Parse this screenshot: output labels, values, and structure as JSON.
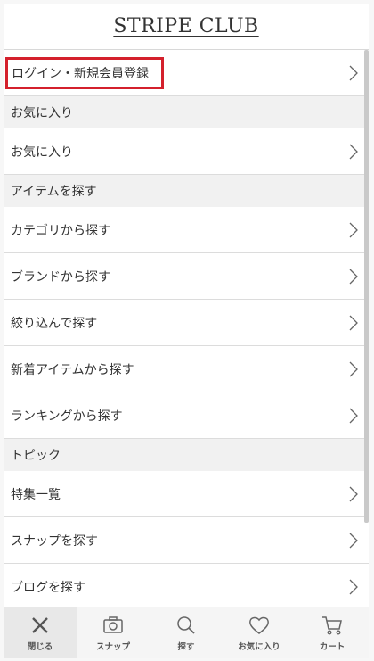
{
  "header": {
    "logo": "STRIPE CLUB"
  },
  "login": {
    "label": "ログイン・新規会員登録"
  },
  "sections": [
    {
      "title": "お気に入り",
      "items": [
        "お気に入り"
      ]
    },
    {
      "title": "アイテムを探す",
      "items": [
        "カテゴリから探す",
        "ブランドから探す",
        "絞り込んで探す",
        "新着アイテムから探す",
        "ランキングから探す"
      ]
    },
    {
      "title": "トピック",
      "items": [
        "特集一覧",
        "スナップを探す",
        "ブログを探す"
      ]
    }
  ],
  "bottom_nav": {
    "items": [
      {
        "label": "閉じる",
        "icon": "close-icon"
      },
      {
        "label": "スナップ",
        "icon": "camera-icon"
      },
      {
        "label": "探す",
        "icon": "search-icon"
      },
      {
        "label": "お気に入り",
        "icon": "heart-icon"
      },
      {
        "label": "カート",
        "icon": "cart-icon"
      }
    ]
  },
  "colors": {
    "highlight": "#d4202c",
    "section_bg": "#f1f1f1",
    "nav_bg": "#f5f5f5"
  }
}
